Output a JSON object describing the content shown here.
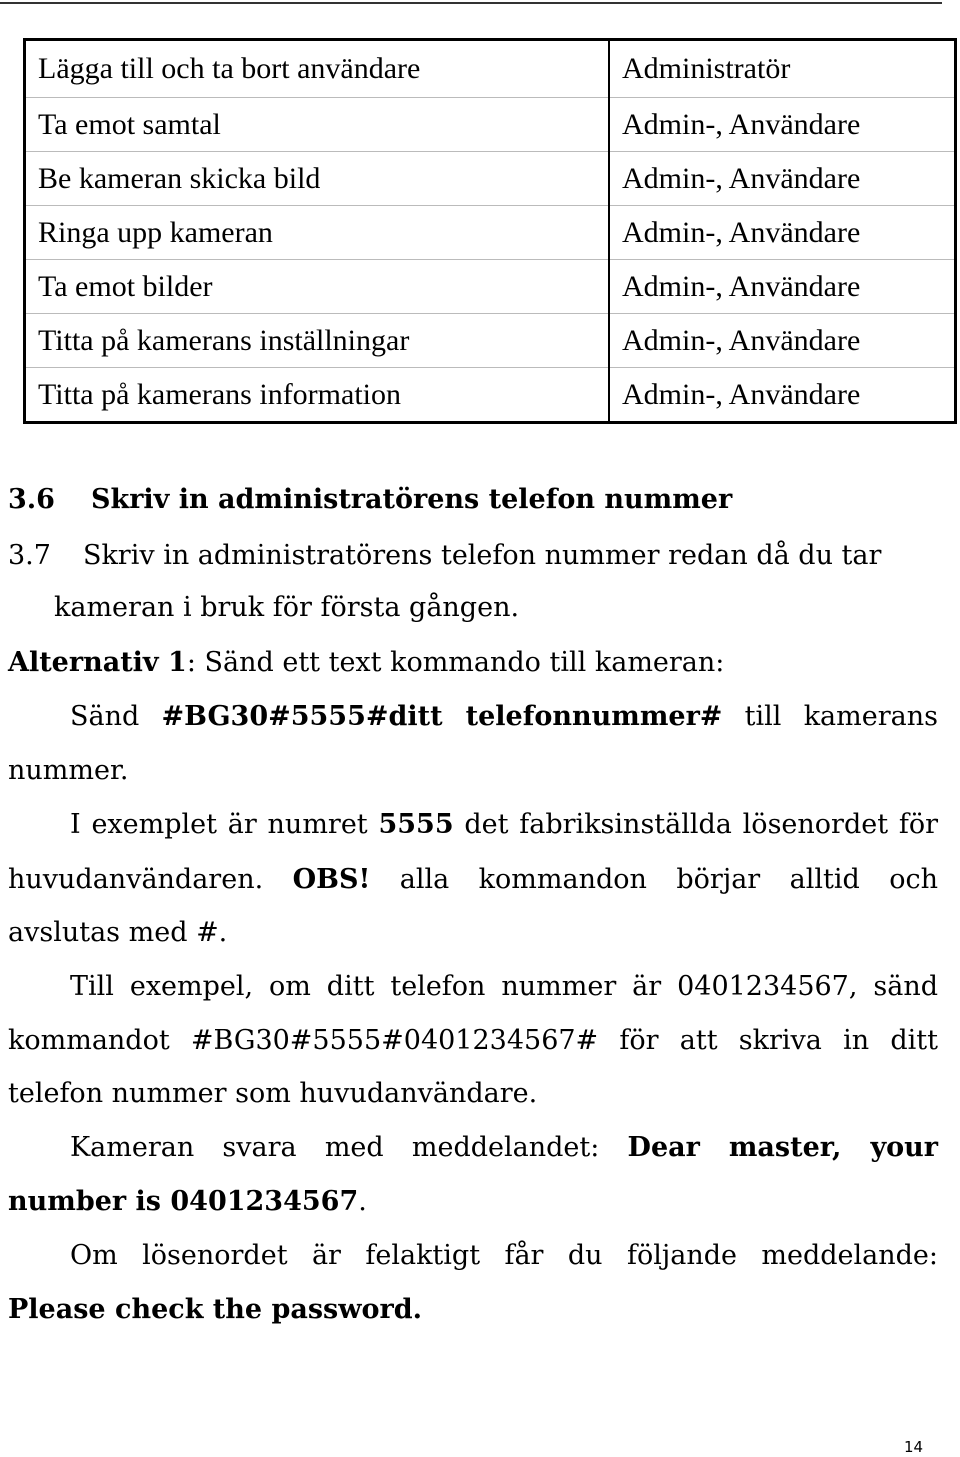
{
  "table": {
    "rows": [
      [
        "Lägga till och ta bort användare",
        "Administratör"
      ],
      [
        "Ta emot samtal",
        "Admin-, Användare"
      ],
      [
        "Be kameran skicka bild",
        "Admin-, Användare"
      ],
      [
        "Ringa upp kameran",
        "Admin-, Användare"
      ],
      [
        "Ta emot bilder",
        "Admin-, Användare"
      ],
      [
        "Titta på kamerans inställningar",
        "Admin-, Användare"
      ],
      [
        "Titta på kamerans information",
        "Admin-, Användare"
      ]
    ]
  },
  "heading": {
    "number": "3.6",
    "title": "Skriv in administratörens telefon nummer"
  },
  "body": {
    "l1": [
      "3.7",
      "Skriv in administratörens telefon nummer redan då du tar"
    ],
    "l2": "kameran i bruk för första gången.",
    "l3": [
      "Alternativ 1",
      ": Sänd ett text kommando till kameran:"
    ],
    "l4": [
      "Sänd ",
      "#BG30#5555#ditt telefonnummer#",
      " till kamerans"
    ],
    "l5": "nummer.",
    "l6": [
      "I exemplet är numret ",
      "5555",
      " det fabriksinställda lösenordet för"
    ],
    "l7": [
      "huvudanvändaren. ",
      "OBS!",
      " alla kommandon börjar alltid och"
    ],
    "l8": "avslutas med #.",
    "l9": "Till exempel, om ditt telefon nummer är 0401234567, sänd",
    "l10": "kommandot #BG30#5555#0401234567# för att skriva in ditt",
    "l11": "telefon nummer som huvudanvändare.",
    "l12": [
      "Kameran svara med meddelandet: ",
      "Dear master, your"
    ],
    "l13": [
      "number is 0401234567",
      "."
    ],
    "l14": "Om lösenordet är felaktigt får du följande meddelande:",
    "l15": "Please check the password."
  },
  "page_number": "14"
}
